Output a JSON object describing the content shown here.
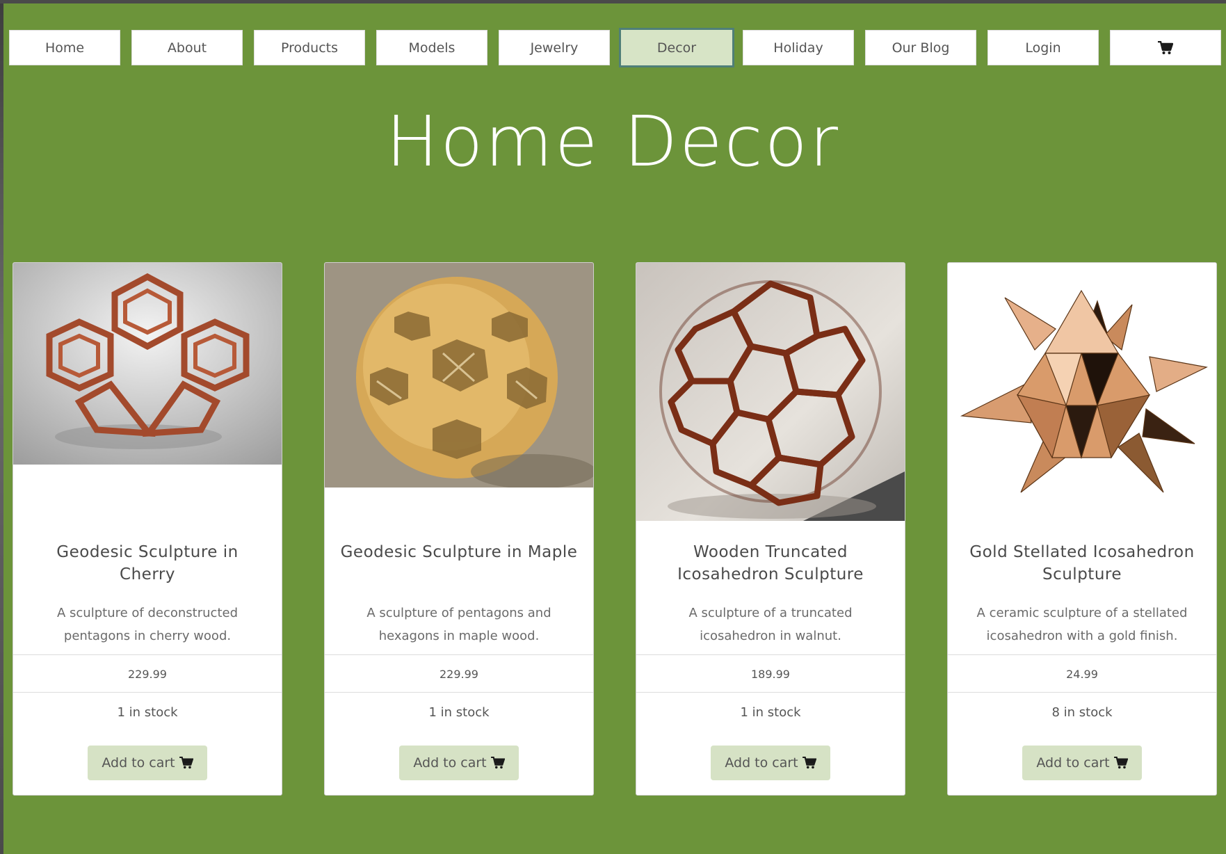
{
  "nav": {
    "items": [
      {
        "label": "Home"
      },
      {
        "label": "About"
      },
      {
        "label": "Products"
      },
      {
        "label": "Models"
      },
      {
        "label": "Jewelry"
      },
      {
        "label": "Decor",
        "active": true
      },
      {
        "label": "Holiday"
      },
      {
        "label": "Our Blog"
      },
      {
        "label": "Login"
      }
    ],
    "cart_icon": "shopping-cart-icon"
  },
  "page": {
    "title": "Home Decor"
  },
  "products": [
    {
      "title": "Geodesic Sculpture in Cherry",
      "description": "A sculpture of deconstructed pentagons in cherry wood.",
      "price": "229.99",
      "stock": "1 in stock",
      "button": "Add to cart"
    },
    {
      "title": "Geodesic Sculpture in Maple",
      "description": "A sculpture of pentagons and hexagons in maple wood.",
      "price": "229.99",
      "stock": "1 in stock",
      "button": "Add to cart"
    },
    {
      "title": "Wooden Truncated Icosahedron Sculpture",
      "description": "A sculpture of a truncated icosahedron in walnut.",
      "price": "189.99",
      "stock": "1 in stock",
      "button": "Add to cart"
    },
    {
      "title": "Gold Stellated Icosahedron Sculpture",
      "description": "A ceramic sculpture of a stellated icosahedron with a gold finish.",
      "price": "24.99",
      "stock": "8 in stock",
      "button": "Add to cart"
    }
  ],
  "colors": {
    "background": "#6c943a",
    "active_nav": "#d7e4c6",
    "button_bg": "#d6e2c5"
  }
}
